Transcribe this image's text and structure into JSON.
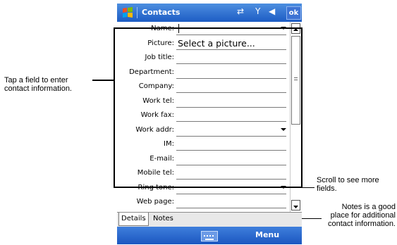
{
  "window": {
    "title": "Contacts",
    "ok_label": "ok",
    "icons": [
      "windows-start-icon",
      "connectivity-icon",
      "signal-icon",
      "volume-icon"
    ]
  },
  "form": {
    "fields": [
      {
        "label": "Name:",
        "value": "",
        "dropdown": true,
        "focused": true
      },
      {
        "label": "Picture:",
        "value": "Select a picture...",
        "dropdown": false
      },
      {
        "label": "Job title:",
        "value": "",
        "dropdown": false
      },
      {
        "label": "Department:",
        "value": "",
        "dropdown": false
      },
      {
        "label": "Company:",
        "value": "",
        "dropdown": false
      },
      {
        "label": "Work tel:",
        "value": "",
        "dropdown": false
      },
      {
        "label": "Work fax:",
        "value": "",
        "dropdown": false
      },
      {
        "label": "Work addr:",
        "value": "",
        "dropdown": true
      },
      {
        "label": "IM:",
        "value": "",
        "dropdown": false
      },
      {
        "label": "E-mail:",
        "value": "",
        "dropdown": false
      },
      {
        "label": "Mobile tel:",
        "value": "",
        "dropdown": false
      },
      {
        "label": "Ring tone:",
        "value": "",
        "dropdown": true
      },
      {
        "label": "Web page:",
        "value": "",
        "dropdown": false
      }
    ]
  },
  "tabs": [
    {
      "label": "Details",
      "active": true
    },
    {
      "label": "Notes",
      "active": false
    }
  ],
  "menubar": {
    "menu_label": "Menu"
  },
  "callouts": {
    "left": "Tap a field to enter\ncontact information.",
    "scroll": "Scroll to see more\nfields.",
    "notes": "Notes is a good\nplace for additional\ncontact information."
  },
  "colors": {
    "titlebar": "#1d5cc4",
    "menubar": "#1b56c0"
  }
}
